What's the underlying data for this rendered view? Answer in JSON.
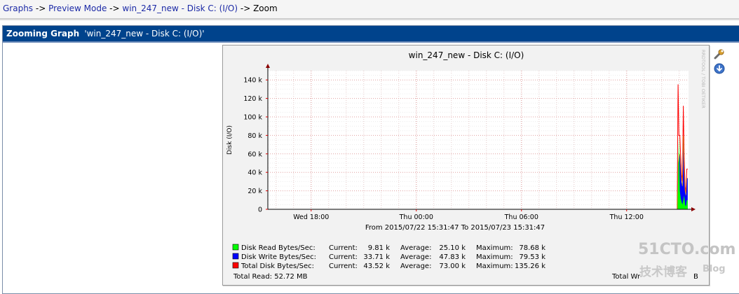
{
  "breadcrumb": {
    "items": [
      "Graphs",
      "Preview Mode",
      "win_247_new - Disk C: (I/O)"
    ],
    "current": "Zoom",
    "separator": "->"
  },
  "panel": {
    "title_prefix": "Zooming Graph",
    "title_name": "'win_247_new - Disk C: (I/O)'"
  },
  "graph": {
    "title": "win_247_new - Disk C: (I/O)",
    "ylabel": "Disk (I/O)",
    "side_text": "RRDTOOL / TOBI OETIKER",
    "date_range": "From 2015/07/22 15:31:47 To 2015/07/23 15:31:47",
    "total_read": "Total Read: 52.72 MB",
    "total_write_partial": "Total Wr",
    "total_write_tail": "B"
  },
  "legend": [
    {
      "label": "Disk Read Bytes/Sec:",
      "current_label": "Current:",
      "current": "9.81 k",
      "average_label": "Average:",
      "average": "25.10 k",
      "maximum_label": "Maximum:",
      "maximum": "78.68 k",
      "color": "#00ff00"
    },
    {
      "label": "Disk Write Bytes/Sec:",
      "current_label": "Current:",
      "current": "33.71 k",
      "average_label": "Average:",
      "average": "47.83 k",
      "maximum_label": "Maximum:",
      "maximum": "79.53 k",
      "color": "#0000ff"
    },
    {
      "label": "Total Disk Bytes/Sec:",
      "current_label": "Current:",
      "current": "43.52 k",
      "average_label": "Average:",
      "average": "73.00 k",
      "maximum_label": "Maximum:",
      "maximum": "135.26 k",
      "color": "#ff0000"
    }
  ],
  "icons": {
    "properties": "wrench-icon",
    "download": "download-icon"
  },
  "watermark": {
    "brand": "51CTO.com",
    "cn": "技术博客",
    "blog": "Blog"
  },
  "chart_data": {
    "type": "area",
    "title": "win_247_new - Disk C: (I/O)",
    "ylabel": "Disk (I/O)",
    "ylim": [
      0,
      150000
    ],
    "yticks": [
      0,
      20000,
      40000,
      60000,
      80000,
      100000,
      120000,
      140000
    ],
    "ytick_labels": [
      "0",
      "20 k",
      "40 k",
      "60 k",
      "80 k",
      "100 k",
      "120 k",
      "140 k"
    ],
    "xlim": [
      "2015-07-22 15:31:47",
      "2015-07-23 15:31:47"
    ],
    "xticks": [
      "2015-07-22 18:00",
      "2015-07-23 00:00",
      "2015-07-23 06:00",
      "2015-07-23 12:00"
    ],
    "xtick_labels": [
      "Wed 18:00",
      "Thu 00:00",
      "Thu 06:00",
      "Thu 12:00"
    ],
    "grid": true,
    "series": [
      {
        "name": "Disk Read Bytes/Sec",
        "color": "#00ff00",
        "x": [
          "2015-07-23 14:53",
          "2015-07-23 14:56",
          "2015-07-23 14:59",
          "2015-07-23 15:02",
          "2015-07-23 15:05",
          "2015-07-23 15:08",
          "2015-07-23 15:11",
          "2015-07-23 15:14",
          "2015-07-23 15:17",
          "2015-07-23 15:20",
          "2015-07-23 15:23",
          "2015-07-23 15:26",
          "2015-07-23 15:29"
        ],
        "values": [
          0,
          30000,
          78680,
          20000,
          12000,
          8000,
          5000,
          10000,
          15000,
          5000,
          3000,
          9810,
          9810
        ]
      },
      {
        "name": "Disk Write Bytes/Sec",
        "color": "#0000ff",
        "x": [
          "2015-07-23 14:53",
          "2015-07-23 14:56",
          "2015-07-23 14:59",
          "2015-07-23 15:02",
          "2015-07-23 15:05",
          "2015-07-23 15:08",
          "2015-07-23 15:11",
          "2015-07-23 15:14",
          "2015-07-23 15:17",
          "2015-07-23 15:20",
          "2015-07-23 15:23",
          "2015-07-23 15:26",
          "2015-07-23 15:29"
        ],
        "values": [
          0,
          50000,
          57000,
          60000,
          45000,
          30000,
          25000,
          79530,
          40000,
          20000,
          15000,
          33710,
          33710
        ]
      },
      {
        "name": "Total Disk Bytes/Sec",
        "color": "#ff0000",
        "x": [
          "2015-07-23 14:53",
          "2015-07-23 14:56",
          "2015-07-23 14:59",
          "2015-07-23 15:02",
          "2015-07-23 15:05",
          "2015-07-23 15:08",
          "2015-07-23 15:11",
          "2015-07-23 15:14",
          "2015-07-23 15:17",
          "2015-07-23 15:20",
          "2015-07-23 15:23",
          "2015-07-23 15:26",
          "2015-07-23 15:29"
        ],
        "values": [
          0,
          135260,
          80000,
          80000,
          57000,
          38000,
          30000,
          112000,
          55000,
          25000,
          18000,
          43520,
          43520
        ]
      }
    ]
  }
}
